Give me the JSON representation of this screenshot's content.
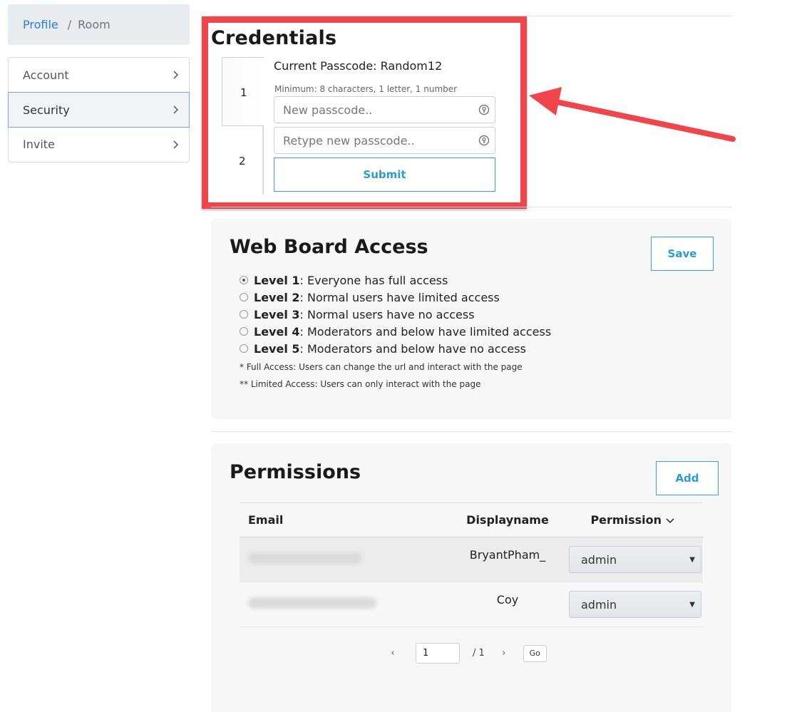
{
  "breadcrumb": {
    "link": "Profile",
    "separator": "/",
    "current": "Room"
  },
  "sidebar": {
    "items": [
      {
        "label": "Account"
      },
      {
        "label": "Security"
      },
      {
        "label": "Invite"
      }
    ]
  },
  "credentials": {
    "title": "Credentials",
    "steps": [
      "1",
      "2"
    ],
    "current_passcode": "Current Passcode: Random12",
    "hint": "Minimum: 8 characters, 1 letter, 1 number",
    "new_placeholder": "New passcode..",
    "retype_placeholder": "Retype new passcode..",
    "submit_label": "Submit"
  },
  "webboard": {
    "title": "Web Board Access",
    "save_label": "Save",
    "levels": [
      {
        "name": "Level 1",
        "desc": ": Everyone has full access",
        "checked": true
      },
      {
        "name": "Level 2",
        "desc": ": Normal users have limited access",
        "checked": false
      },
      {
        "name": "Level 3",
        "desc": ": Normal users have no access",
        "checked": false
      },
      {
        "name": "Level 4",
        "desc": ": Moderators and below have limited access",
        "checked": false
      },
      {
        "name": "Level 5",
        "desc": ": Moderators and below have no access",
        "checked": false
      }
    ],
    "note_full": "* Full Access: Users can change the url and interact with the page",
    "note_limited": "** Limited Access: Users can only interact with the page"
  },
  "permissions": {
    "title": "Permissions",
    "add_label": "Add",
    "columns": {
      "email": "Email",
      "displayname": "Displayname",
      "permission": "Permission"
    },
    "rows": [
      {
        "displayname": "BryantPham_",
        "permission": "admin"
      },
      {
        "displayname": "Coy",
        "permission": "admin"
      }
    ],
    "pager": {
      "prev": "‹",
      "page": "1",
      "total": "/ 1",
      "next": "›",
      "go_label": "Go"
    }
  },
  "colors": {
    "accent": "#2a9bd6",
    "highlight": "#f2454b",
    "link": "#2a7ae2"
  }
}
